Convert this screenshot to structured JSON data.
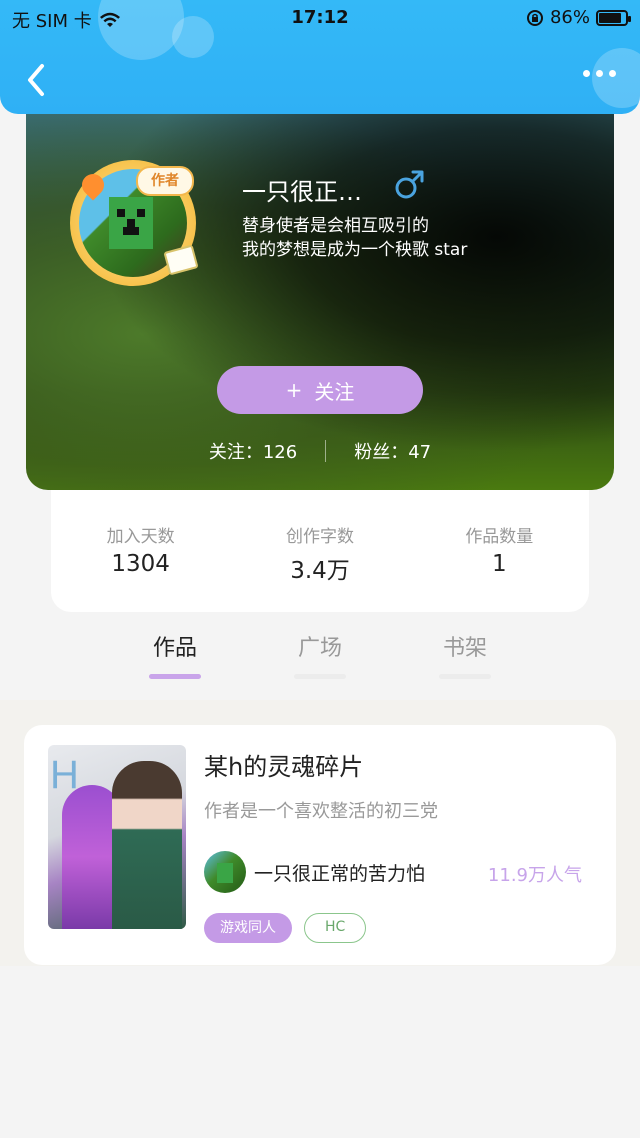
{
  "status_bar": {
    "carrier": "无 SIM 卡",
    "time": "17:12",
    "battery": "86%",
    "battery_level": 0.86
  },
  "nav": {
    "back_icon": "chevron-left-icon",
    "more_icon": "more-dots-icon"
  },
  "profile": {
    "username": "一只很正…",
    "gender": "male",
    "author_badge": "作者",
    "bio_line1": "替身使者是会相互吸引的",
    "bio_line2": "我的梦想是成为一个秧歌 star",
    "follow_plus": "+",
    "follow_label": "关注",
    "following_label": "关注：",
    "following_count": "126",
    "fans_label": "粉丝：",
    "fans_count": "47"
  },
  "info": {
    "items": [
      {
        "label": "加入天数",
        "value": "1304"
      },
      {
        "label": "创作字数",
        "value": "3.4万"
      },
      {
        "label": "作品数量",
        "value": "1"
      }
    ]
  },
  "tabs": [
    {
      "label": "作品",
      "active": true
    },
    {
      "label": "广场",
      "active": false
    },
    {
      "label": "书架",
      "active": false
    }
  ],
  "works": [
    {
      "title": "某h的灵魂碎片",
      "description": "作者是一个喜欢整活的初三党",
      "author": "一只很正常的苦力怕",
      "popularity": "11.9万人气",
      "cover_letter": "H",
      "tags": [
        "游戏同人",
        "HC"
      ]
    }
  ],
  "colors": {
    "header_blue": "#34b9f7",
    "accent_purple": "#c49ae6",
    "tag_green": "#8bc68c",
    "gender_blue": "#4aa3df"
  }
}
